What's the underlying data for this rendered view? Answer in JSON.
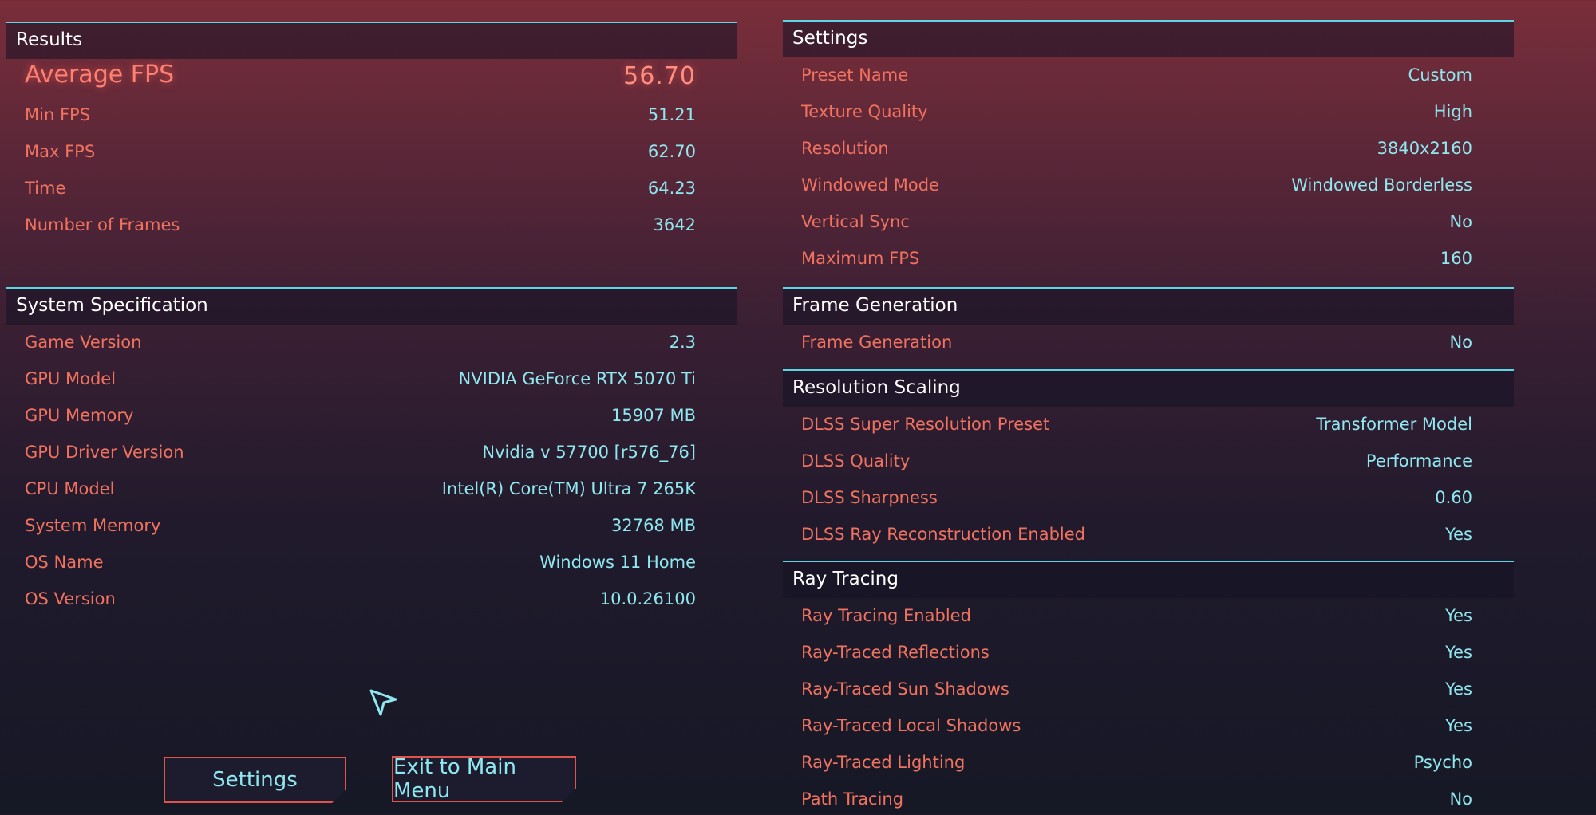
{
  "results": {
    "title": "Results",
    "rows": [
      {
        "label": "Average FPS",
        "value": "56.70"
      },
      {
        "label": "Min FPS",
        "value": "51.21"
      },
      {
        "label": "Max FPS",
        "value": "62.70"
      },
      {
        "label": "Time",
        "value": "64.23"
      },
      {
        "label": "Number of Frames",
        "value": "3642"
      }
    ]
  },
  "system": {
    "title": "System Specification",
    "rows": [
      {
        "label": "Game Version",
        "value": "2.3"
      },
      {
        "label": "GPU Model",
        "value": "NVIDIA GeForce RTX 5070 Ti"
      },
      {
        "label": "GPU Memory",
        "value": "15907 MB"
      },
      {
        "label": "GPU Driver Version",
        "value": "Nvidia v 57700 [r576_76]"
      },
      {
        "label": "CPU Model",
        "value": "Intel(R) Core(TM) Ultra 7 265K"
      },
      {
        "label": "System Memory",
        "value": "32768 MB"
      },
      {
        "label": "OS Name",
        "value": "Windows 11 Home"
      },
      {
        "label": "OS Version",
        "value": "10.0.26100"
      }
    ]
  },
  "settings": {
    "title": "Settings",
    "rows": [
      {
        "label": "Preset Name",
        "value": "Custom"
      },
      {
        "label": "Texture Quality",
        "value": "High"
      },
      {
        "label": "Resolution",
        "value": "3840x2160"
      },
      {
        "label": "Windowed Mode",
        "value": "Windowed Borderless"
      },
      {
        "label": "Vertical Sync",
        "value": "No"
      },
      {
        "label": "Maximum FPS",
        "value": "160"
      }
    ]
  },
  "frame_generation": {
    "title": "Frame Generation",
    "rows": [
      {
        "label": "Frame Generation",
        "value": "No"
      }
    ]
  },
  "resolution_scaling": {
    "title": "Resolution Scaling",
    "rows": [
      {
        "label": "DLSS Super Resolution Preset",
        "value": "Transformer Model"
      },
      {
        "label": "DLSS Quality",
        "value": "Performance"
      },
      {
        "label": "DLSS Sharpness",
        "value": "0.60"
      },
      {
        "label": "DLSS Ray Reconstruction Enabled",
        "value": "Yes"
      }
    ]
  },
  "ray_tracing": {
    "title": "Ray Tracing",
    "rows": [
      {
        "label": "Ray Tracing Enabled",
        "value": "Yes"
      },
      {
        "label": "Ray-Traced Reflections",
        "value": "Yes"
      },
      {
        "label": "Ray-Traced Sun Shadows",
        "value": "Yes"
      },
      {
        "label": "Ray-Traced Local Shadows",
        "value": "Yes"
      },
      {
        "label": "Ray-Traced Lighting",
        "value": "Psycho"
      },
      {
        "label": "Path Tracing",
        "value": "No"
      }
    ]
  },
  "buttons": {
    "settings_label": "Settings",
    "exit_label": "Exit to Main Menu"
  },
  "icons": {
    "cursor": "cursor-arrow-icon"
  },
  "colors": {
    "accent_cyan": "#5ad6e6",
    "label_red": "#f0725f",
    "value_cyan": "#8fe8ef",
    "button_border": "#e0534a"
  }
}
